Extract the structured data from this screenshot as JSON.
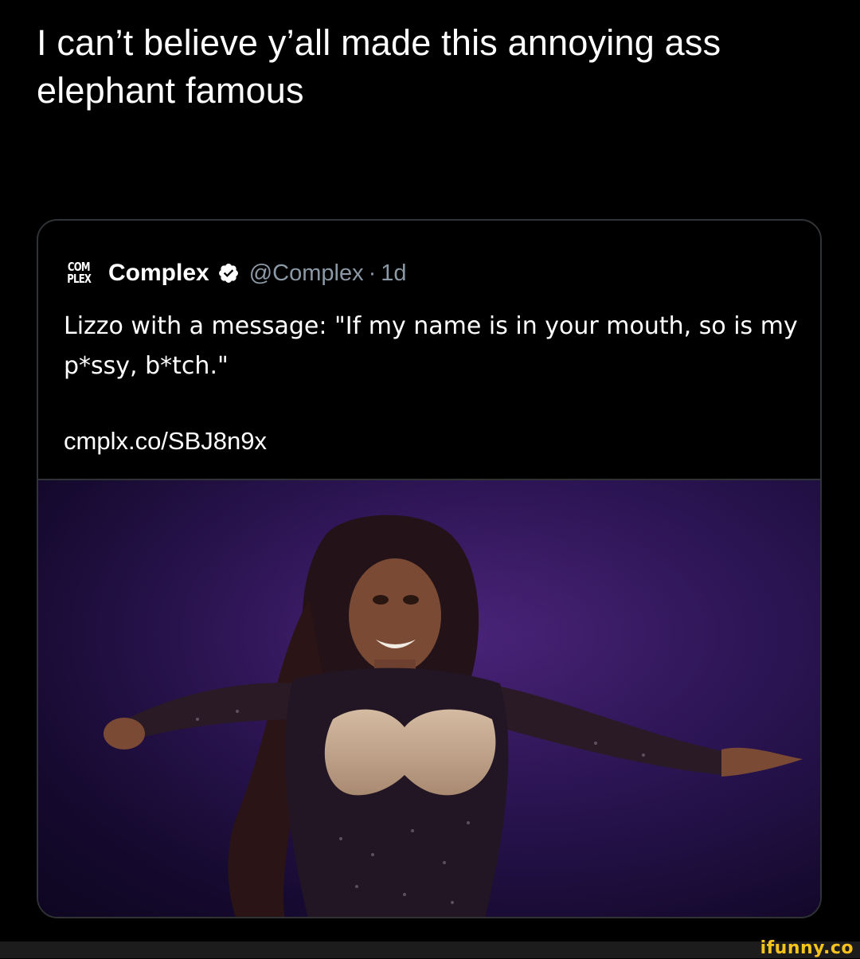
{
  "tweet": {
    "text": "I can’t believe y’all made this annoying ass elephant famous"
  },
  "quoted_tweet": {
    "avatar_logo": [
      "COM",
      "PLEX"
    ],
    "display_name": "Complex",
    "verified_icon": "verified-badge-icon",
    "handle": "@Complex",
    "separator": "·",
    "time": "1d",
    "text": "Lizzo with a message: \"If my name is in your mouth, so is my p*ssy, b*tch.\"",
    "link": "cmplx.co/SBJ8n9x",
    "media": {
      "kind": "photo",
      "subject": "performer on stage with arms outstretched"
    }
  },
  "watermark": {
    "text": "ifunny.co"
  },
  "colors": {
    "background": "#000000",
    "card_border": "#2f3336",
    "muted_text": "#8b98a5",
    "watermark": "#f6c21c",
    "stage_purple": "#2a1452"
  }
}
